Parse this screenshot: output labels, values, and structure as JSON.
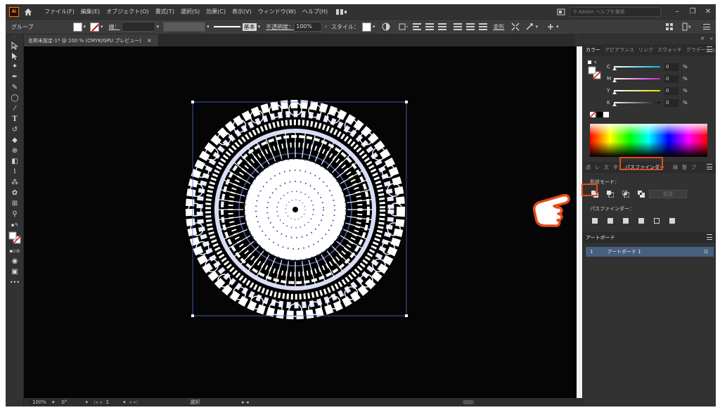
{
  "menubar": {
    "logo": "Ai",
    "items": [
      "ファイル(F)",
      "編集(E)",
      "オブジェクト(O)",
      "書式(T)",
      "選択(S)",
      "効果(C)",
      "表示(V)",
      "ウィンドウ(W)",
      "ヘルプ(H)"
    ],
    "search_placeholder": "Adobe ヘルプを検索"
  },
  "controlbar": {
    "selection": "グループ",
    "stroke_label": "線：",
    "brush_label": "基本",
    "opacity_label": "不透明度：",
    "opacity_value": "100%",
    "style_label": "スタイル：",
    "transform_label": "変形"
  },
  "document": {
    "tab_title": "名称未設定-1* @ 100 % (CMYK/GPU プレビュー)",
    "close": "×"
  },
  "statusbar": {
    "zoom": "100%",
    "rotation": "0°",
    "artboard_num": "1",
    "mode": "選択"
  },
  "color_panel": {
    "tabs": [
      "カラー",
      "アピアランス",
      "リンク",
      "スウォッチ",
      "グラデーション"
    ],
    "channels": [
      {
        "label": "C",
        "value": "0",
        "unit": "%",
        "color": "#00b7eb"
      },
      {
        "label": "M",
        "value": "0",
        "unit": "%",
        "color": "#d020d0"
      },
      {
        "label": "Y",
        "value": "0",
        "unit": "%",
        "color": "#f0e000"
      },
      {
        "label": "K",
        "value": "0",
        "unit": "%",
        "color": "#bbbbbb"
      }
    ]
  },
  "pathfinder_panel": {
    "tabs": [
      "透",
      "レ",
      "文",
      "字",
      "パスファインダー",
      "線",
      "整",
      "ブ"
    ],
    "shape_modes_label": "形状モード：",
    "pathfinders_label": "パスファインダー：",
    "expand_label": "拡張"
  },
  "artboards_panel": {
    "tab": "アートボード",
    "row_number": "1",
    "row_name": "アートボード 1"
  },
  "colors": {
    "highlight": "#e84a1a",
    "selection_blue": "#46607f"
  }
}
